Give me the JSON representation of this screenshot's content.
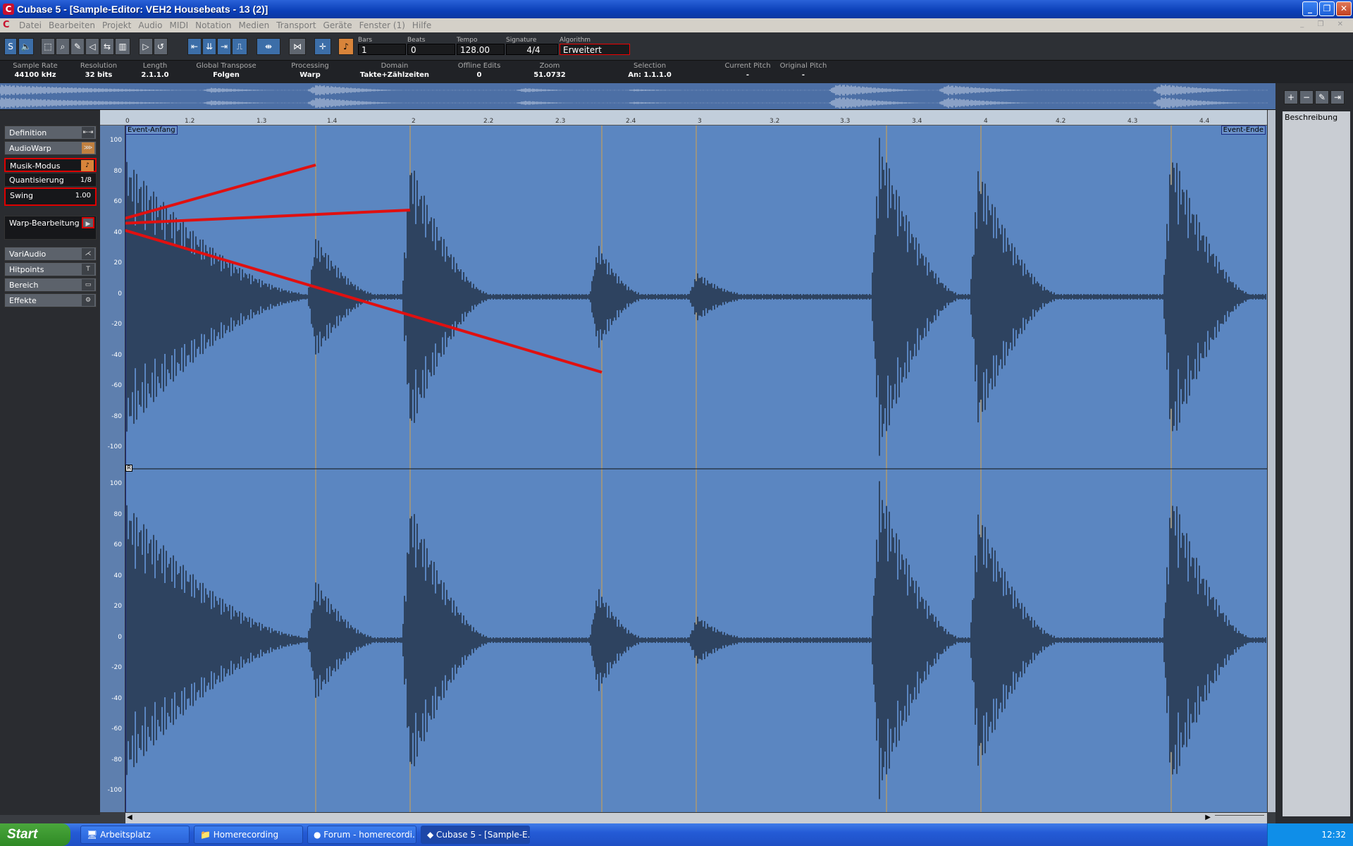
{
  "window": {
    "title": "Cubase 5 - [Sample-Editor: VEH2 Housebeats - 13 (2)]",
    "app_icon": "C"
  },
  "menu": [
    "Datei",
    "Bearbeiten",
    "Projekt",
    "Audio",
    "MIDI",
    "Notation",
    "Medien",
    "Transport",
    "Geräte",
    "Fenster (1)",
    "Hilfe"
  ],
  "toolbar": {
    "solo": "S",
    "bars_label": "Bars",
    "bars": "1",
    "beats_label": "Beats",
    "beats": "0",
    "tempo_label": "Tempo",
    "tempo": "128.00",
    "signature_label": "Signature",
    "signature": "4/4",
    "algorithm_label": "Algorithm",
    "algorithm": "Erweitert"
  },
  "info": [
    {
      "h": "Sample Rate",
      "v": "44100     kHz"
    },
    {
      "h": "Resolution",
      "v": "32     bits"
    },
    {
      "h": "Length",
      "v": "2.1.1.0"
    },
    {
      "h": "Global Transpose",
      "v": "Folgen"
    },
    {
      "h": "Processing",
      "v": "Warp"
    },
    {
      "h": "Domain",
      "v": "Takte+Zählzeiten"
    },
    {
      "h": "Offline Edits",
      "v": "0"
    },
    {
      "h": "Zoom",
      "v": "51.0732"
    },
    {
      "h": "Selection",
      "v": "An: 1.1.1.0"
    },
    {
      "h": "Current Pitch",
      "v": "-"
    },
    {
      "h": "Original Pitch",
      "v": "-"
    }
  ],
  "inspector": {
    "definition": "Definition",
    "audiowarp": "AudioWarp",
    "musik_modus": "Musik-Modus",
    "quantisierung": "Quantisierung",
    "quantisierung_val": "1/8",
    "swing": "Swing",
    "swing_val": "1.00",
    "warp": "Warp-Bearbeitung",
    "variaudio": "VariAudio",
    "hitpoints": "Hitpoints",
    "bereich": "Bereich",
    "effekte": "Effekte"
  },
  "ruler": {
    "ticks": [
      "0",
      "1.2",
      "1.3",
      "1.4",
      "2",
      "2.2",
      "2.3",
      "2.4",
      "3",
      "3.2",
      "3.3",
      "3.4",
      "4",
      "4.2",
      "4.3",
      "4.4"
    ]
  },
  "markers": {
    "start": "Event-Anfang",
    "end": "Event-Ende",
    "r": "R"
  },
  "scale": [
    "100",
    "80",
    "60",
    "40",
    "20",
    "0",
    "-20",
    "-40",
    "-60",
    "-80",
    "-100"
  ],
  "right_panel": {
    "header": "Beschreibung"
  },
  "taskbar": {
    "start": "Start",
    "tasks": [
      "Arbeitsplatz",
      "Homerecording",
      "Forum - homerecordi...",
      "Cubase 5 - [Sample-E..."
    ],
    "clock": "12:32"
  }
}
